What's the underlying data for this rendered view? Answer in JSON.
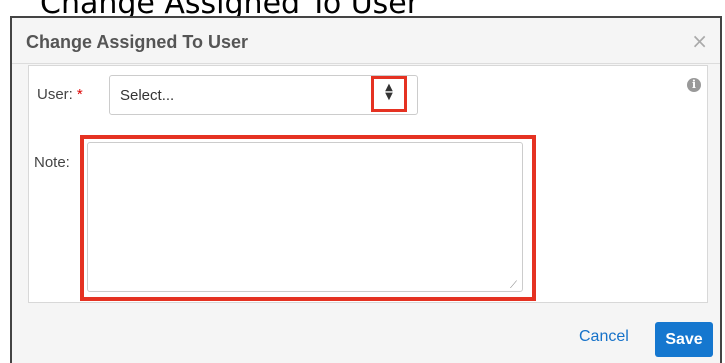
{
  "background": {
    "partial_title": "Change Assigned To User"
  },
  "modal": {
    "title": "Change Assigned To User",
    "close_icon": "×",
    "user_label": "User:",
    "required_marker": "*",
    "user_select_value": "Select...",
    "info_icon": "i",
    "note_label": "Note:",
    "note_value": "",
    "cancel_label": "Cancel",
    "save_label": "Save"
  },
  "colors": {
    "accent": "#1577cf",
    "highlight": "#e53222"
  }
}
